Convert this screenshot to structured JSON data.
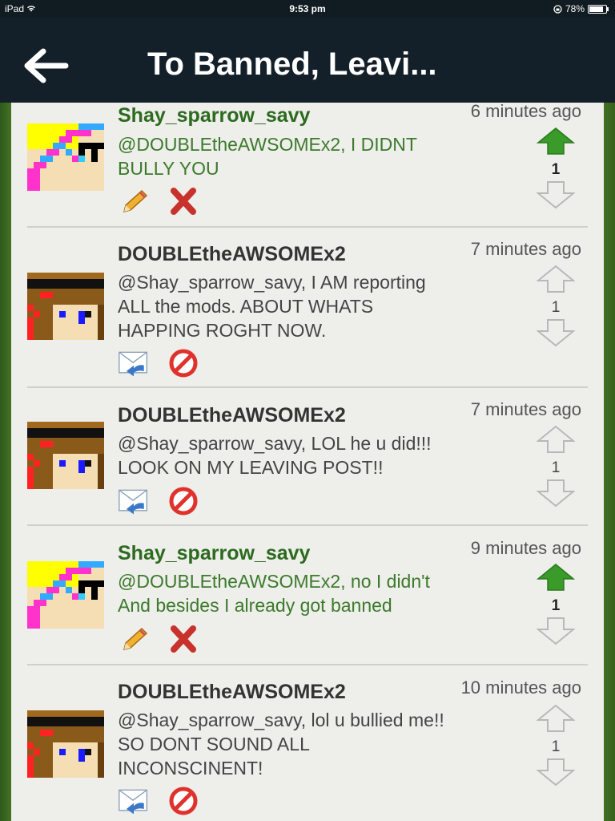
{
  "status_bar": {
    "device": "iPad",
    "time": "9:53 pm",
    "battery": "78%"
  },
  "header": {
    "title": "To Banned, Leavi..."
  },
  "comments": [
    {
      "author": "Shay_sparrow_savy",
      "time": "6 minutes ago",
      "line1": "@DOUBLEtheAWSOMEx2, I DIDNT",
      "line2": "BULLY YOU",
      "line3": "",
      "votes": "1",
      "own": true,
      "upvoted": true
    },
    {
      "author": "DOUBLEtheAWSOMEx2",
      "time": "7 minutes ago",
      "line1": "@Shay_sparrow_savy, I AM reporting",
      "line2": "ALL the mods. ABOUT WHATS",
      "line3": "HAPPING ROGHT NOW.",
      "votes": "1",
      "own": false,
      "upvoted": false
    },
    {
      "author": "DOUBLEtheAWSOMEx2",
      "time": "7 minutes ago",
      "line1": "@Shay_sparrow_savy, LOL he u did!!!",
      "line2": "LOOK ON MY LEAVING POST!!",
      "line3": "",
      "votes": "1",
      "own": false,
      "upvoted": false
    },
    {
      "author": "Shay_sparrow_savy",
      "time": "9 minutes ago",
      "line1": "@DOUBLEtheAWSOMEx2, no I didn't",
      "line2": "And besides I already got banned",
      "line3": "",
      "votes": "1",
      "own": true,
      "upvoted": true
    },
    {
      "author": "DOUBLEtheAWSOMEx2",
      "time": "10 minutes ago",
      "line1": "@Shay_sparrow_savy, lol u bullied me!!",
      "line2": "SO DONT SOUND ALL",
      "line3": "INCONSCINENT!",
      "votes": "1",
      "own": false,
      "upvoted": false
    }
  ],
  "icons": {
    "back": "back-arrow-icon",
    "upvote": "upvote-arrow-icon",
    "downvote": "downvote-arrow-icon",
    "edit": "pencil-icon",
    "delete": "delete-x-icon",
    "reply": "reply-envelope-icon",
    "block": "block-icon"
  },
  "colors": {
    "header_bg": "#13202a",
    "own_name": "#2c6a1f",
    "own_text": "#3c7a2c",
    "upvote_active": "#3a9a2a",
    "delete_red": "#c8322c",
    "block_red": "#e0322c"
  }
}
